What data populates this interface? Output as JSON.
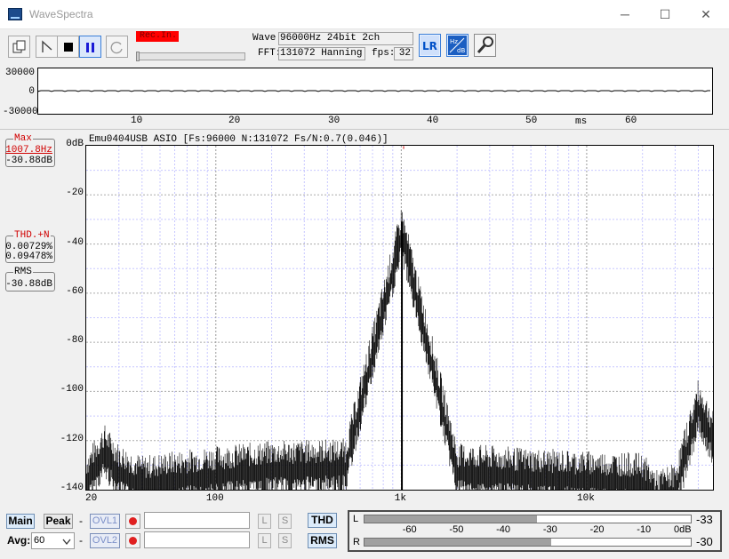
{
  "window": {
    "title": "WaveSpectra",
    "minimize": "─",
    "maximize": "☐",
    "close": "✕"
  },
  "toolbar": {
    "rec_label": "Rec.In.",
    "wave_label": "Wave:",
    "wave_value": "96000Hz 24bit 2ch",
    "fft_label": "FFT:",
    "fft_value": "131072 Hanning",
    "fps_label": "fps:",
    "fps_value": "32",
    "lr_icon_text": "LR",
    "hz_icon_text": "Hz",
    "db_icon_text": "dB",
    "icons": [
      "copy-icon",
      "play-icon",
      "stop-icon",
      "pause-icon",
      "loop-icon",
      "lr-swap-icon",
      "hz-db-icon",
      "settings-wrench-icon"
    ]
  },
  "wave_plot": {
    "y_labels": [
      "30000",
      "0",
      "-30000"
    ],
    "x_labels": [
      "10",
      "20",
      "30",
      "40",
      "50",
      "60"
    ],
    "x_unit": "ms"
  },
  "left_panel": {
    "max_label": "Max",
    "max_freq": "1007.8Hz",
    "max_level": "-30.88dB",
    "thd_label": "THD.+N",
    "thd_value1": "0.00729%",
    "thd_value2": "0.09478%",
    "rms_label": "RMS",
    "rms_value": "-30.88dB"
  },
  "spectrum": {
    "header": "Emu0404USB ASIO  [Fs:96000 N:131072 Fs/N:0.7(0.046)]",
    "y_labels": [
      "0dB",
      "-20",
      "-40",
      "-60",
      "-80",
      "-100",
      "-120",
      "-140"
    ],
    "x_labels": [
      "20",
      "100",
      "1k",
      "10k"
    ],
    "peak_marker": "'"
  },
  "chart_data": {
    "type": "line",
    "title": "Emu0404USB ASIO  [Fs:96000 N:131072 Fs/N:0.7(0.046)]",
    "xscale": "log",
    "xlim": [
      20,
      48000
    ],
    "ylim": [
      -140,
      0
    ],
    "grid": true,
    "x_tick_labels": [
      "20",
      "100",
      "1k",
      "10k"
    ],
    "y_tick_labels": [
      "0dB",
      "-20",
      "-40",
      "-60",
      "-80",
      "-100",
      "-120",
      "-140"
    ],
    "series": [
      {
        "color": "#000000",
        "peak": {
          "x": 1007.8,
          "y": -30.88
        },
        "x": [
          20,
          25,
          30,
          40,
          60,
          100,
          200,
          500,
          1007.8,
          2000,
          5000,
          10000,
          20000,
          24000,
          30000,
          40000,
          47000
        ],
        "y": [
          -132,
          -120,
          -128,
          -133,
          -131,
          -129,
          -127,
          -126,
          -30.88,
          -128,
          -130,
          -131,
          -132,
          -139,
          -136,
          -102,
          -113
        ]
      }
    ]
  },
  "bottom": {
    "main_label": "Main",
    "peak_label": "Peak",
    "avg_label": "Avg:",
    "avg_value": "60",
    "dash": "-",
    "ovl1_label": "OVL1",
    "ovl2_label": "OVL2",
    "l_label": "L",
    "s_label": "S",
    "thd_btn": "THD",
    "rms_btn": "RMS",
    "meter": {
      "left_label": "L",
      "right_label": "R",
      "scale": [
        "-60",
        "-50",
        "-40",
        "-30",
        "-20",
        "-10",
        "0dB"
      ],
      "left_level_db": -33,
      "right_level_db": -30,
      "left_value": "-33",
      "right_value": "-30"
    }
  }
}
